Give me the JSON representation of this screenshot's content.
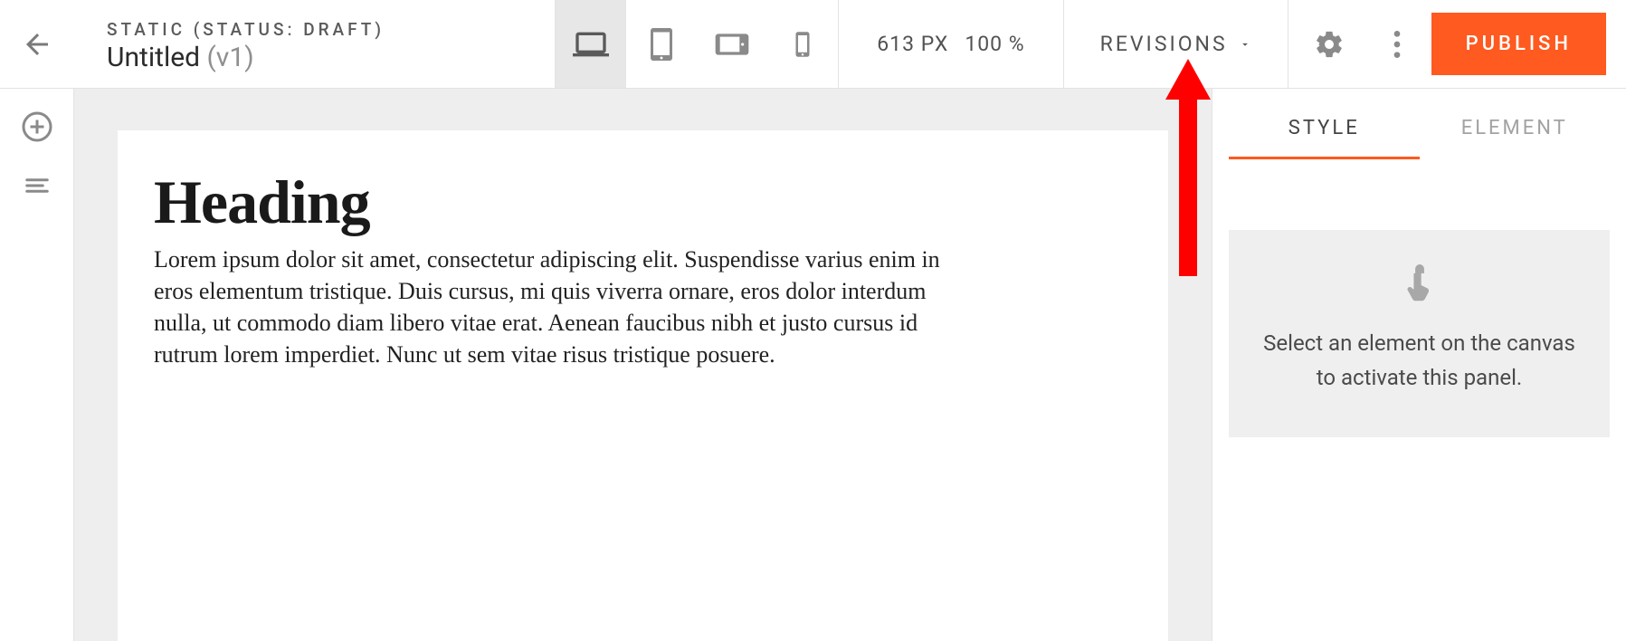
{
  "header": {
    "status_line": "STATIC (STATUS: DRAFT)",
    "title": "Untitled",
    "version": "(v1)",
    "zoom_px": "613 PX",
    "zoom_pct": "100 %",
    "revisions_label": "REVISIONS",
    "publish_label": "PUBLISH"
  },
  "right_panel": {
    "tabs": {
      "style": "STYLE",
      "element": "ELEMENT"
    },
    "empty_line1": "Select an element on the canvas",
    "empty_line2": "to activate this panel."
  },
  "canvas": {
    "heading": "Heading",
    "body": "Lorem ipsum dolor sit amet, consectetur adipiscing elit. Suspendisse varius enim in eros elementum tristique. Duis cursus, mi quis viverra ornare, eros dolor interdum nulla, ut commodo diam libero vitae erat. Aenean faucibus nibh et justo cursus id rutrum lorem imperdiet. Nunc ut sem vitae risus tristique posuere."
  }
}
